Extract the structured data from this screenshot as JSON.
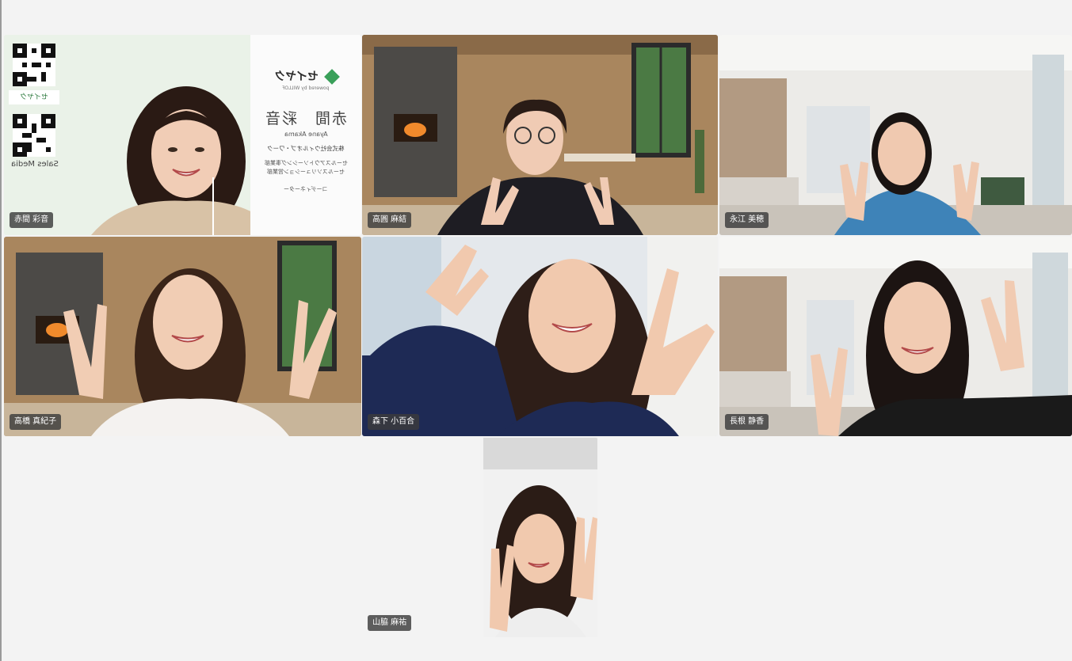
{
  "participants": [
    {
      "name": "赤間 彩音"
    },
    {
      "name": "高圓 麻結"
    },
    {
      "name": "永江 美穂"
    },
    {
      "name": "高橋 真紀子"
    },
    {
      "name": "森下 小百合"
    },
    {
      "name": "長根 静香"
    },
    {
      "name": "山脇 麻祐"
    }
  ],
  "virtual_background": {
    "logo_text": "セイヤク",
    "powered_by": "powered by WILLOF",
    "card_name": "赤間　彩音",
    "card_romaji": "Ayane Akama",
    "company": "株式会社ウィルオブ・ワーク",
    "dept_1": "セールスアウトソーシング事業部",
    "dept_2": "セールスソリューション営業部",
    "role": "コーディネーター",
    "sales_media": "Sales Media"
  },
  "colors": {
    "page_bg": "#f3f3f3",
    "name_tag_bg": "#3c3c3c",
    "brand_green": "#3aa05a"
  }
}
